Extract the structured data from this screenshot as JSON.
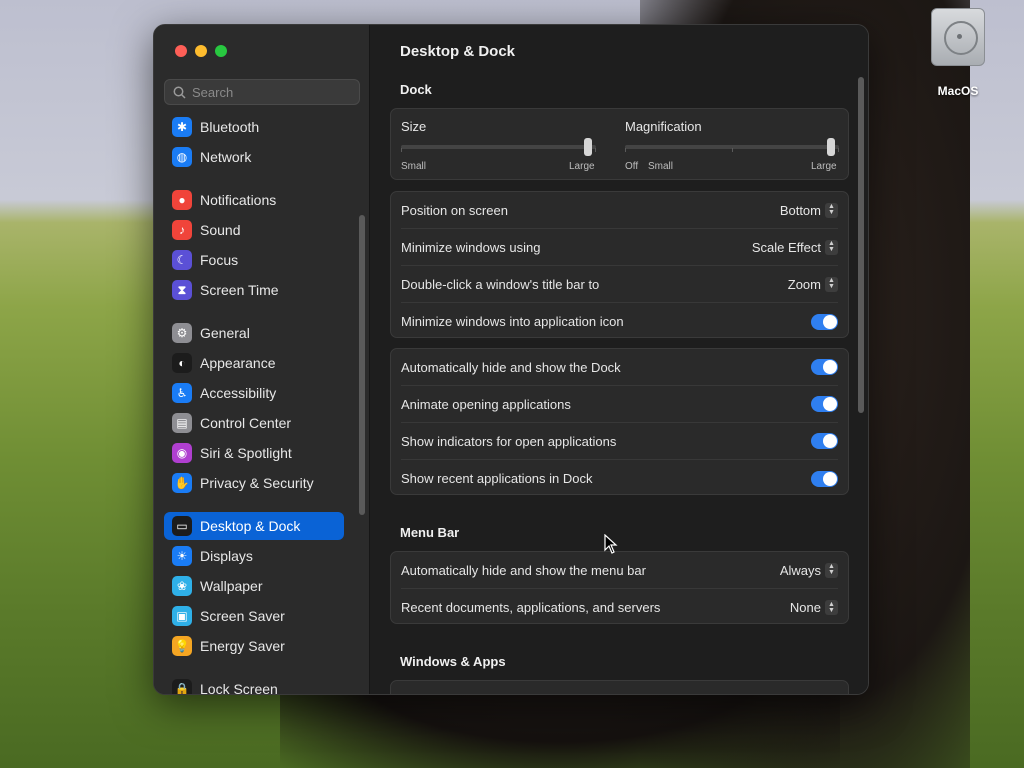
{
  "desktop": {
    "icon_label": "MacOS"
  },
  "sidebar": {
    "search_placeholder": "Search",
    "items": [
      {
        "label": "Bluetooth",
        "color": "#1a7cf5",
        "glyph": "✱"
      },
      {
        "label": "Network",
        "color": "#1a7cf5",
        "glyph": "◍"
      },
      {
        "label": "Notifications",
        "color": "#f0443a",
        "glyph": "●"
      },
      {
        "label": "Sound",
        "color": "#f0443a",
        "glyph": "♪"
      },
      {
        "label": "Focus",
        "color": "#5b50d6",
        "glyph": "☾"
      },
      {
        "label": "Screen Time",
        "color": "#5b50d6",
        "glyph": "⧗"
      },
      {
        "label": "General",
        "color": "#8e8e93",
        "glyph": "⚙"
      },
      {
        "label": "Appearance",
        "color": "#1c1c1c",
        "glyph": "◐"
      },
      {
        "label": "Accessibility",
        "color": "#1a7cf5",
        "glyph": "♿"
      },
      {
        "label": "Control Center",
        "color": "#8e8e93",
        "glyph": "▤"
      },
      {
        "label": "Siri & Spotlight",
        "color": "#b03fd0",
        "glyph": "◉"
      },
      {
        "label": "Privacy & Security",
        "color": "#1a7cf5",
        "glyph": "✋"
      },
      {
        "label": "Desktop & Dock",
        "color": "#1c1c1c",
        "glyph": "▭"
      },
      {
        "label": "Displays",
        "color": "#1a7cf5",
        "glyph": "☀"
      },
      {
        "label": "Wallpaper",
        "color": "#2fb0e8",
        "glyph": "❀"
      },
      {
        "label": "Screen Saver",
        "color": "#2fb0e8",
        "glyph": "▣"
      },
      {
        "label": "Energy Saver",
        "color": "#f5a623",
        "glyph": "💡"
      },
      {
        "label": "Lock Screen",
        "color": "#1c1c1c",
        "glyph": "🔒"
      }
    ]
  },
  "content": {
    "title": "Desktop & Dock",
    "dock_section": "Dock",
    "size": {
      "label": "Size",
      "min": "Small",
      "max": "Large",
      "value": 0.98
    },
    "magnification": {
      "label": "Magnification",
      "min": "Off",
      "mid": "Small",
      "max": "Large",
      "value": 0.98
    },
    "rows1": [
      {
        "label": "Position on screen",
        "value": "Bottom"
      },
      {
        "label": "Minimize windows using",
        "value": "Scale Effect"
      },
      {
        "label": "Double-click a window's title bar to",
        "value": "Zoom"
      },
      {
        "label": "Minimize windows into application icon",
        "toggle": true
      }
    ],
    "rows2": [
      {
        "label": "Automatically hide and show the Dock",
        "toggle": true
      },
      {
        "label": "Animate opening applications",
        "toggle": true
      },
      {
        "label": "Show indicators for open applications",
        "toggle": true
      },
      {
        "label": "Show recent applications in Dock",
        "toggle": true
      }
    ],
    "menubar_section": "Menu Bar",
    "rows3": [
      {
        "label": "Automatically hide and show the menu bar",
        "value": "Always"
      },
      {
        "label": "Recent documents, applications, and servers",
        "value": "None"
      }
    ],
    "windows_section": "Windows & Apps"
  }
}
